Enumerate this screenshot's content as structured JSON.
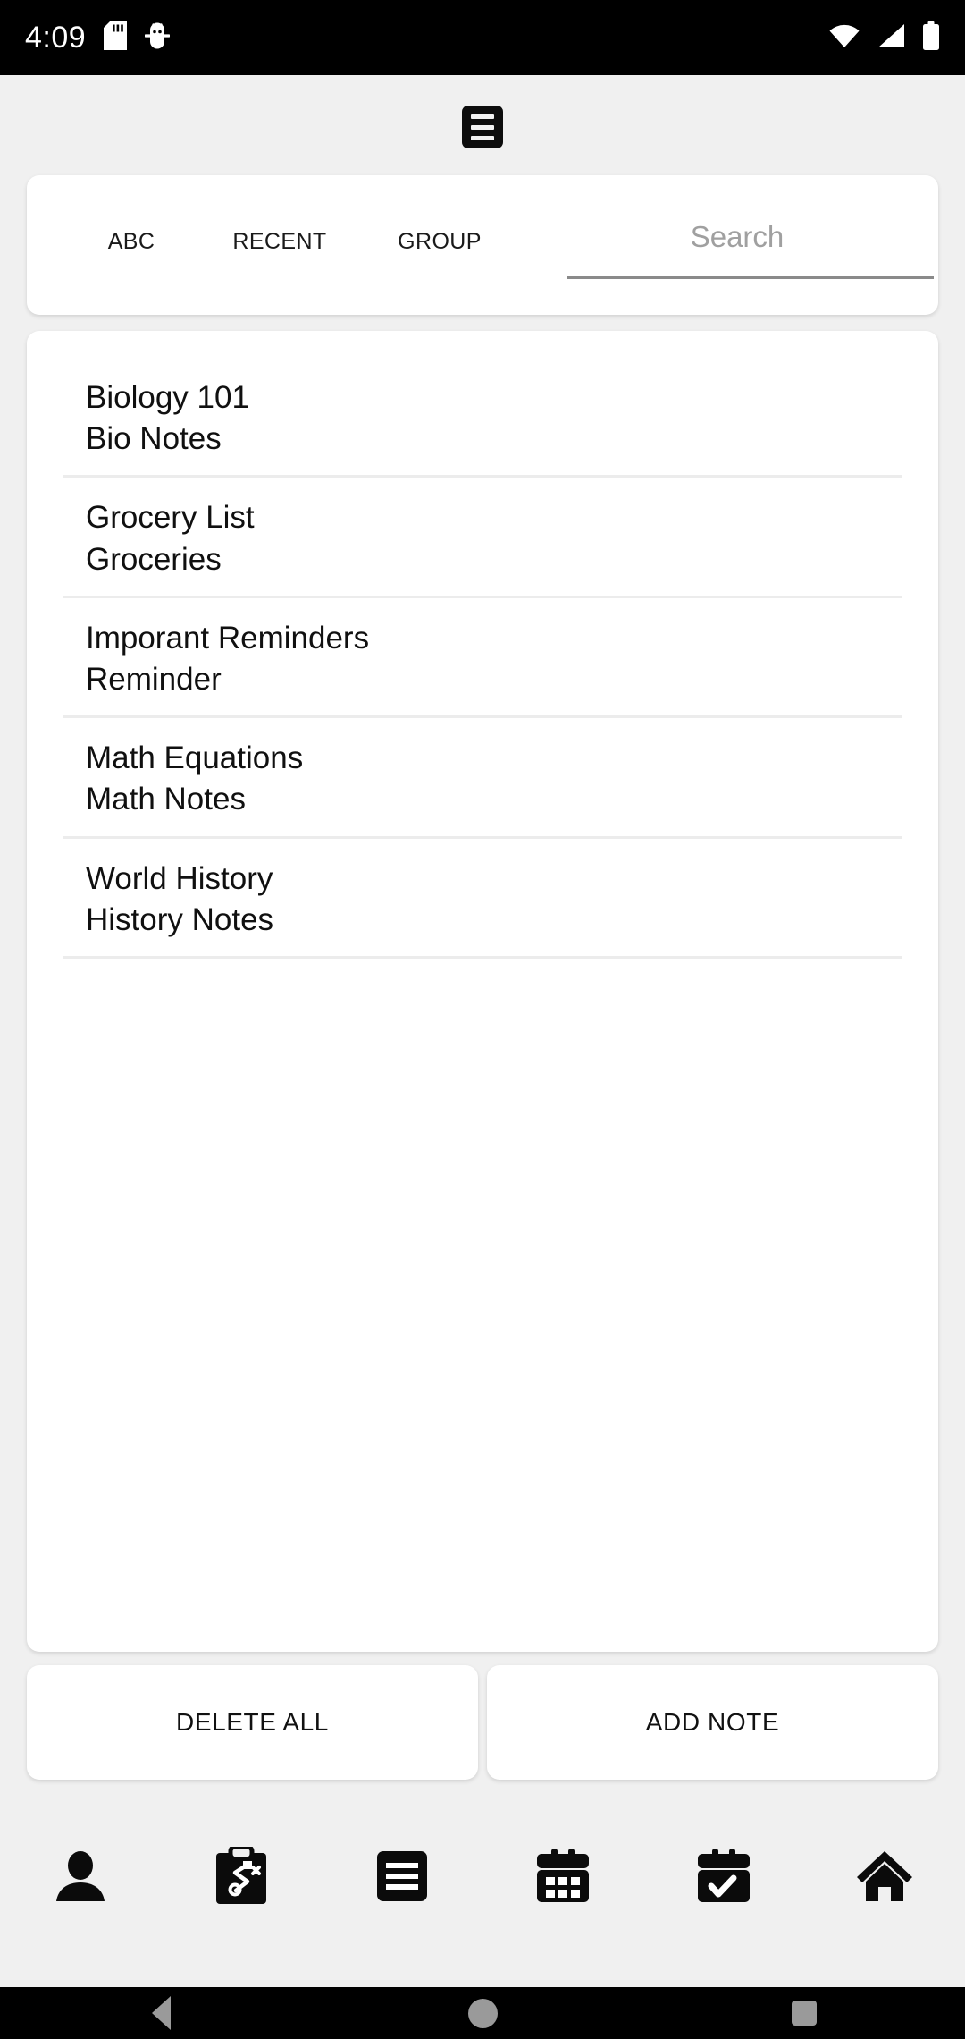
{
  "status_bar": {
    "time": "4:09",
    "left_icons": [
      "sd-card-icon",
      "android-debug-icon"
    ],
    "right_icons": [
      "wifi-icon",
      "cellular-signal-icon",
      "battery-icon"
    ]
  },
  "toolbar": {
    "menu_icon": "hamburger-menu-icon"
  },
  "tabs": [
    {
      "label": "ABC"
    },
    {
      "label": "RECENT"
    },
    {
      "label": "GROUP"
    }
  ],
  "search": {
    "placeholder": "Search",
    "value": ""
  },
  "notes": [
    {
      "title": "Biology 101",
      "subtitle": "Bio Notes"
    },
    {
      "title": "Grocery List",
      "subtitle": "Groceries"
    },
    {
      "title": "Imporant Reminders",
      "subtitle": "Reminder"
    },
    {
      "title": "Math Equations",
      "subtitle": "Math Notes"
    },
    {
      "title": "World History",
      "subtitle": "History Notes"
    }
  ],
  "actions": {
    "delete_all_label": "DELETE ALL",
    "add_note_label": "ADD NOTE"
  },
  "bottom_nav": [
    {
      "icon": "person-icon"
    },
    {
      "icon": "clipboard-playbook-icon"
    },
    {
      "icon": "notes-list-icon"
    },
    {
      "icon": "calendar-icon"
    },
    {
      "icon": "calendar-check-icon"
    },
    {
      "icon": "home-icon"
    }
  ],
  "android_nav": [
    {
      "icon": "back-icon"
    },
    {
      "icon": "home-circle-icon"
    },
    {
      "icon": "recents-square-icon"
    }
  ],
  "colors": {
    "app_background": "#f0f0f0",
    "card_background": "#ffffff",
    "status_bar": "#000000",
    "text_primary": "#101010",
    "placeholder": "#a0a0a0",
    "divider": "#ececec",
    "system_nav_icon": "#9a9a9a"
  }
}
